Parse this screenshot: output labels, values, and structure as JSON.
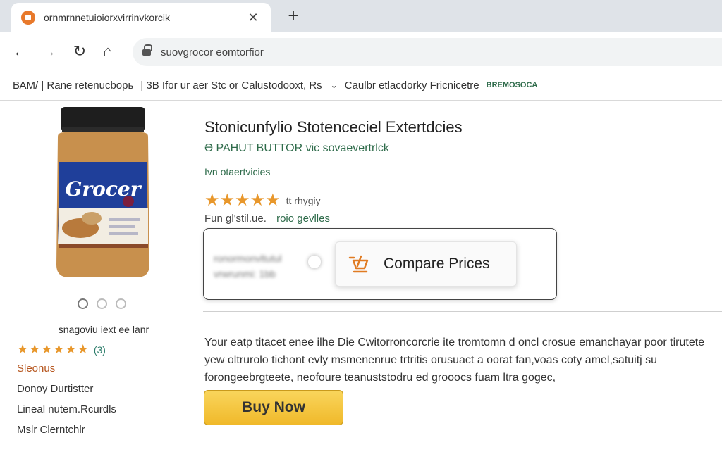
{
  "browser": {
    "tab_title": "ornmrnnetuioiorxvirrinvkorcik",
    "url": "suovgrocor eomtorfior"
  },
  "site_nav": {
    "crumb1": "ВАМ/ | Rane retenucbopь",
    "crumb2": "| 3B Ifor ur aer Stc or Calustodooxt, Rs",
    "crumb3": "Caulbr etlacdorky Fricnicetre",
    "tag": "BREMOSOCA"
  },
  "product": {
    "jar_brand": "Grocer",
    "title": "Stonicunfylio Stotenceciel Extertdcies",
    "subtitle": "Ə PAHUT BUTTOR vic sovaevertrlck",
    "brand_line": "Ivn otaertvicies",
    "stars": "★★★★★",
    "rating_text": "tt rhygiy",
    "meta_text": "Fun gl'stil.ue.",
    "meta_link": "roio gevlles",
    "description": "Your eatp titacet enee ilhe Die Cwitorroncorcrie ite tromtomn d oncl crosue emanchayar poor tirutete yew oltrurolo tichont evly msmenenrue trtritis orusuact a oorat fan,voas coty amel,satuitj su forongeebrgteete, neofoure teanuststodru ed grooocs fuam ltra gogec,"
  },
  "compare": {
    "blur_line1": "ronormonvltutul",
    "blur_line2": "vrwrunmi: 1bb",
    "label": "Compare Prices"
  },
  "buy": {
    "label": "Buy Now"
  },
  "left": {
    "sub_label": "snagoviu iext ee lanr",
    "stars": "★★★★★★",
    "review_count": "(3)",
    "link": "Sleonus",
    "items": [
      "Donoy Durtistter",
      "Lineal nutem.Rcurdls",
      "Mslr Clerntchlr"
    ]
  },
  "colors": {
    "accent_green": "#2e6b4a",
    "star_orange": "#e8972b",
    "buy_yellow": "#f0b92a",
    "link_orange": "#b5541c"
  }
}
